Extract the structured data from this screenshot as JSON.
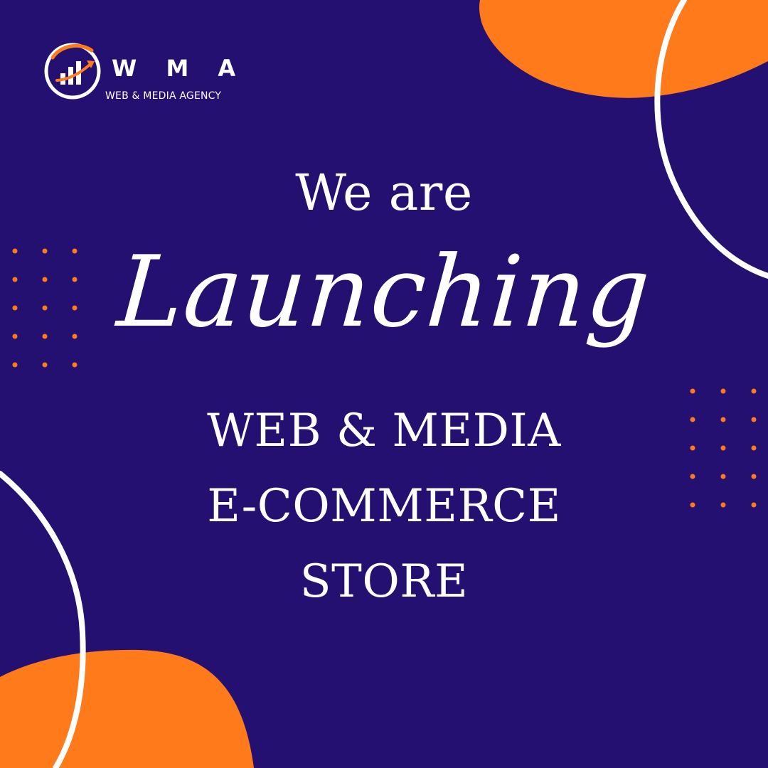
{
  "brand": {
    "name": "W M A",
    "tagline": "WEB & MEDIA AGENCY",
    "logo_icon": "bar-chart-arrow-icon"
  },
  "announcement": {
    "intro": "We are",
    "headline": "Launching",
    "lines": [
      "WEB & MEDIA",
      "E-COMMERCE",
      "STORE"
    ]
  },
  "colors": {
    "background": "#231070",
    "accent": "#FF7A1A",
    "text": "#FFFFFF",
    "line": "#FFFFFF"
  }
}
